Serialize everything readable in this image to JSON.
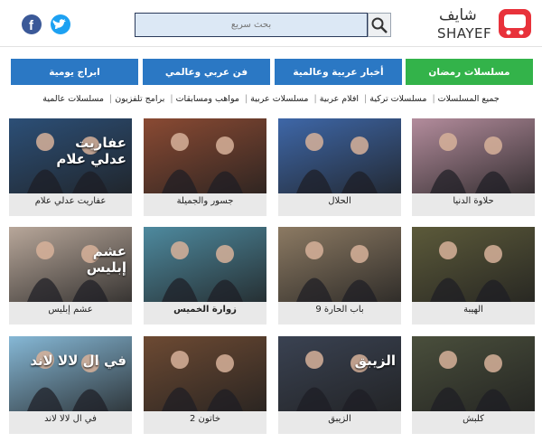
{
  "header": {
    "logo_ar": "شايف",
    "logo_en": "SHAYEF",
    "search_placeholder": "بحث سريع",
    "social": {
      "facebook_icon": "f",
      "twitter_icon": "twitter-bird"
    }
  },
  "tabs": [
    {
      "label": "مسلسلات رمضان",
      "color": "#33b34a"
    },
    {
      "label": "أخبار عربية وعالمية",
      "color": "#2b78c4"
    },
    {
      "label": "فن عربي وعالمي",
      "color": "#2b78c4"
    },
    {
      "label": "ابراج يومية",
      "color": "#2b78c4"
    }
  ],
  "categories": [
    "جميع المسلسلات",
    "مسلسلات تركية",
    "افلام عربية",
    "مسلسلات عربية",
    "مواهب ومسابقات",
    "برامج تلفزيون",
    "مسلسلات عالمية"
  ],
  "cards": [
    {
      "title": "حلاوة الدنيا",
      "bg": "#b38c9c"
    },
    {
      "title": "الحلال",
      "bg": "#3e67a8"
    },
    {
      "title": "جسور والجميلة",
      "bg": "#8a4a33"
    },
    {
      "title": "عفاريت عدلي علام",
      "bg": "#2c4f77",
      "overlay": "عفاريت\nعدلي علام"
    },
    {
      "title": "الهيبة",
      "bg": "#5c5a3a"
    },
    {
      "title": "باب الحارة 9",
      "bg": "#8c7a63"
    },
    {
      "title": "زوارة الخميس",
      "bg": "#4e8a9f",
      "bold": true
    },
    {
      "title": "عشم إبليس",
      "bg": "#b8a79a",
      "overlay": "عشم\nإبليس"
    },
    {
      "title": "كلبش",
      "bg": "#4a4f3c"
    },
    {
      "title": "الزيبق",
      "bg": "#3a4252",
      "overlay": "الزيبق"
    },
    {
      "title": "خاتون 2",
      "bg": "#6d4a33"
    },
    {
      "title": "في ال لالا لاند",
      "bg": "#86b8d6",
      "overlay": "في ال لالا لاند"
    }
  ]
}
